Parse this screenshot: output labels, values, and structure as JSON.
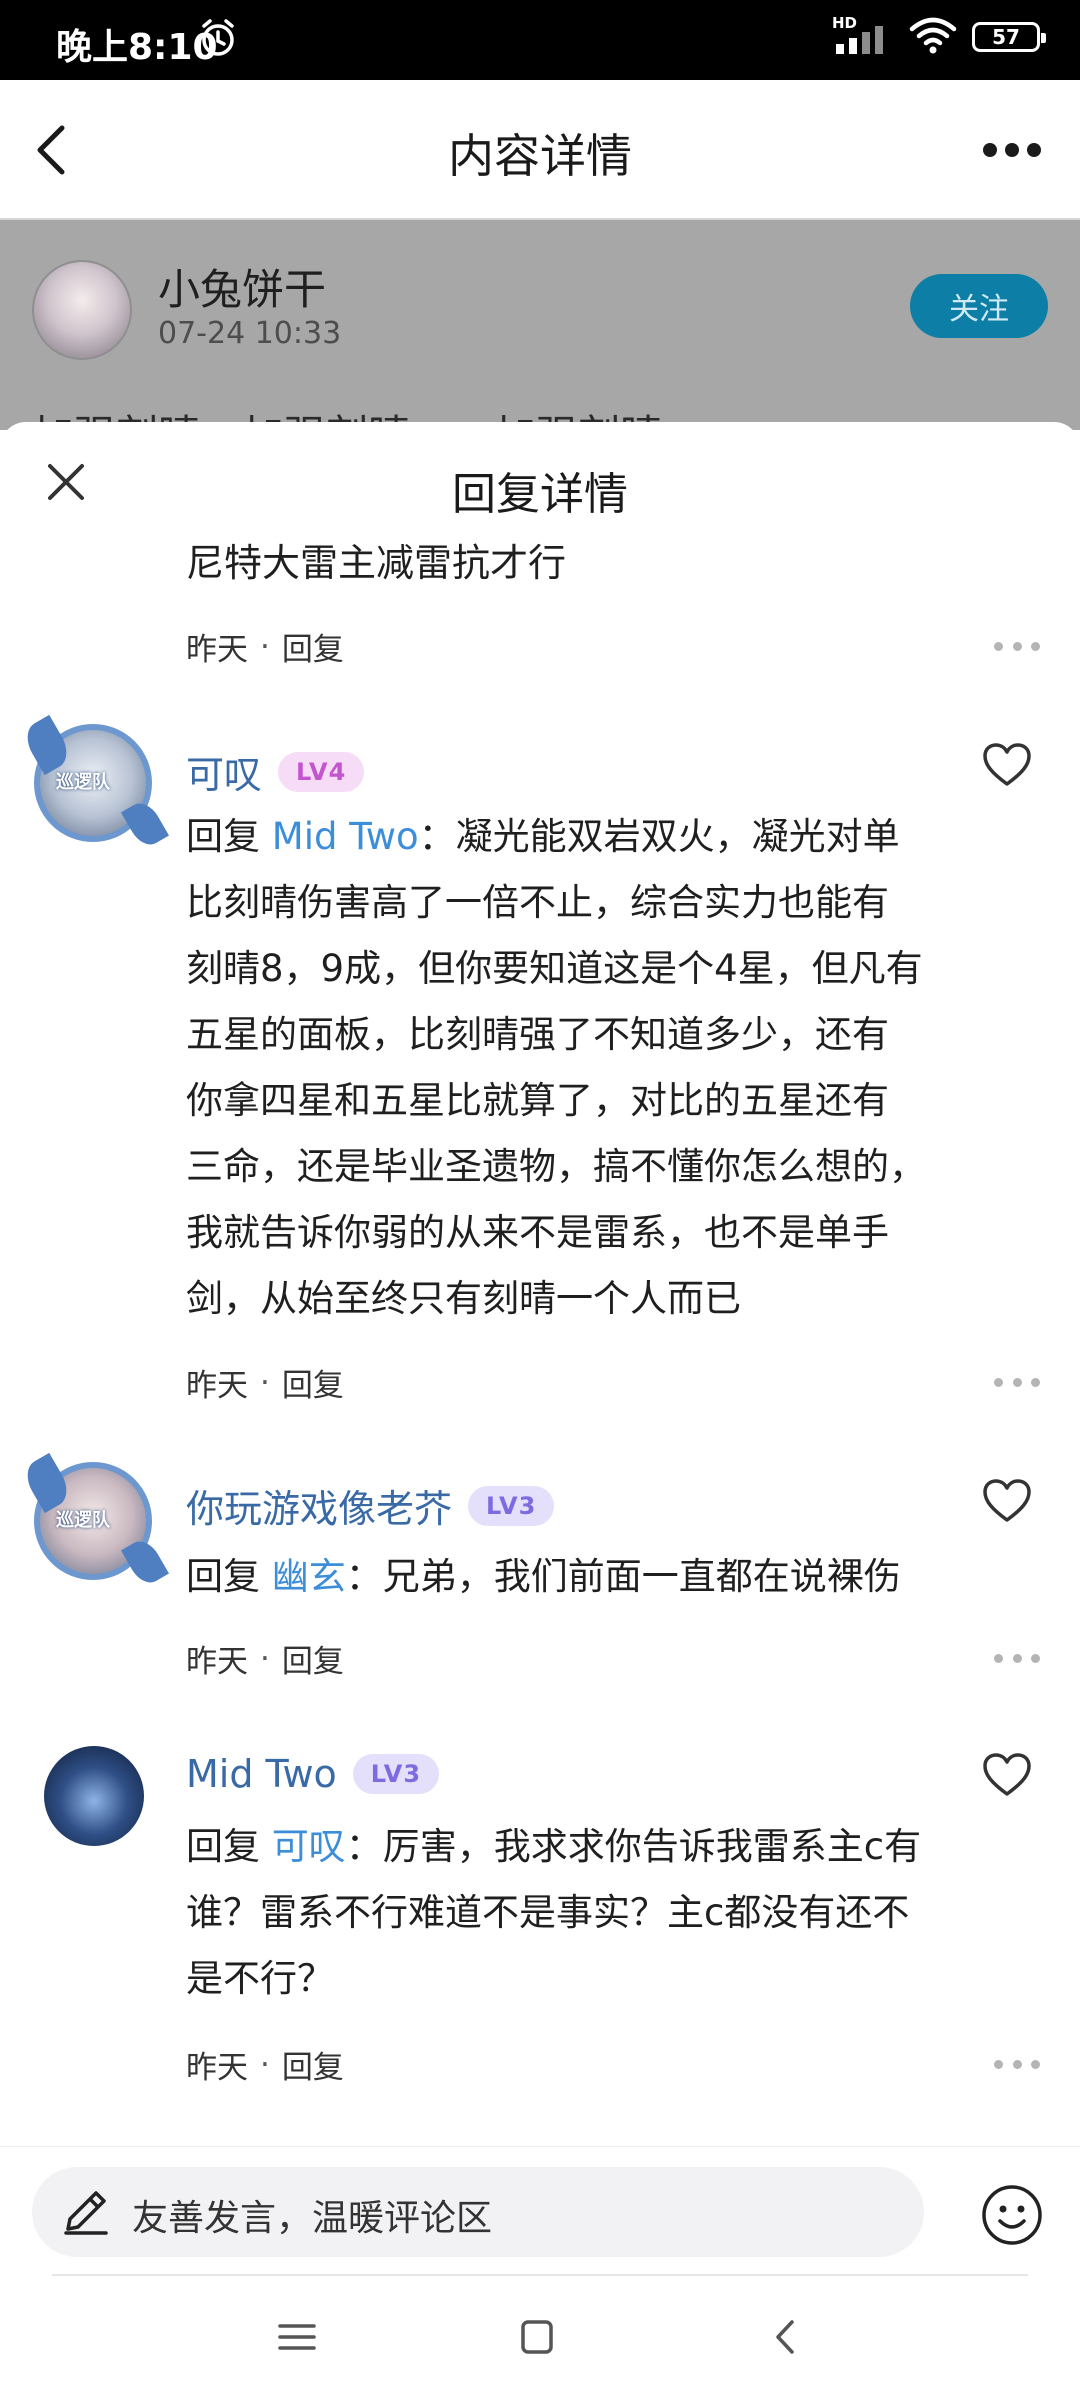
{
  "status_bar": {
    "time": "晚上8:10",
    "network": "HD",
    "battery": "57"
  },
  "header": {
    "title": "内容详情"
  },
  "post": {
    "author": "小兔饼干",
    "time": "07-24 10:33",
    "follow_label": "关注",
    "peek_text": "加强刻晴，加强刻晴……加强刻晴"
  },
  "sheet": {
    "title": "回复详情",
    "prev_tail": {
      "text": "尼特大雷主减雷抗才行",
      "time": "昨天",
      "reply_label": "回复"
    },
    "comments": [
      {
        "name": "可叹",
        "level": "LV4",
        "avatar_badge": "巡逻队",
        "reply_prefix": "回复",
        "reply_to": "Mid Two",
        "separator": "：",
        "lines": [
          "凝光能双岩双火，凝光对单",
          "比刻晴伤害高了一倍不止，综合实力也能有",
          "刻晴8，9成，但你要知道这是个4星，但凡有",
          "五星的面板，比刻晴强了不知道多少，还有",
          "你拿四星和五星比就算了，对比的五星还有",
          "三命，还是毕业圣遗物，搞不懂你怎么想的，",
          "我就告诉你弱的从来不是雷系，也不是单手",
          "剑，从始至终只有刻晴一个人而已"
        ],
        "time": "昨天",
        "reply_label": "回复"
      },
      {
        "name": "你玩游戏像老芥",
        "level": "LV3",
        "avatar_badge": "巡逻队",
        "reply_prefix": "回复",
        "reply_to": "幽玄",
        "separator": "：",
        "lines": [
          "兄弟，我们前面一直都在说裸伤"
        ],
        "time": "昨天",
        "reply_label": "回复"
      },
      {
        "name": "Mid Two",
        "level": "LV3",
        "reply_prefix": "回复",
        "reply_to": "可叹",
        "separator": "：",
        "lines": [
          "厉害，我求求你告诉我雷系主c有",
          "谁？雷系不行难道不是事实？主c都没有还不",
          "是不行？"
        ],
        "time": "昨天",
        "reply_label": "回复"
      }
    ]
  },
  "input": {
    "placeholder": "友善发言，温暖评论区"
  },
  "icons": {
    "back": "chevron-left-icon",
    "more": "more-horizontal-icon",
    "close": "close-icon",
    "like": "heart-icon",
    "edit": "pen-icon",
    "emoji": "smiley-icon"
  },
  "colors": {
    "follow_button": "#0d7ea6",
    "username": "#3a6aa6",
    "mention": "#3d8ed8",
    "lv4_text": "#c355cf",
    "lv3_text": "#7d6be0"
  }
}
